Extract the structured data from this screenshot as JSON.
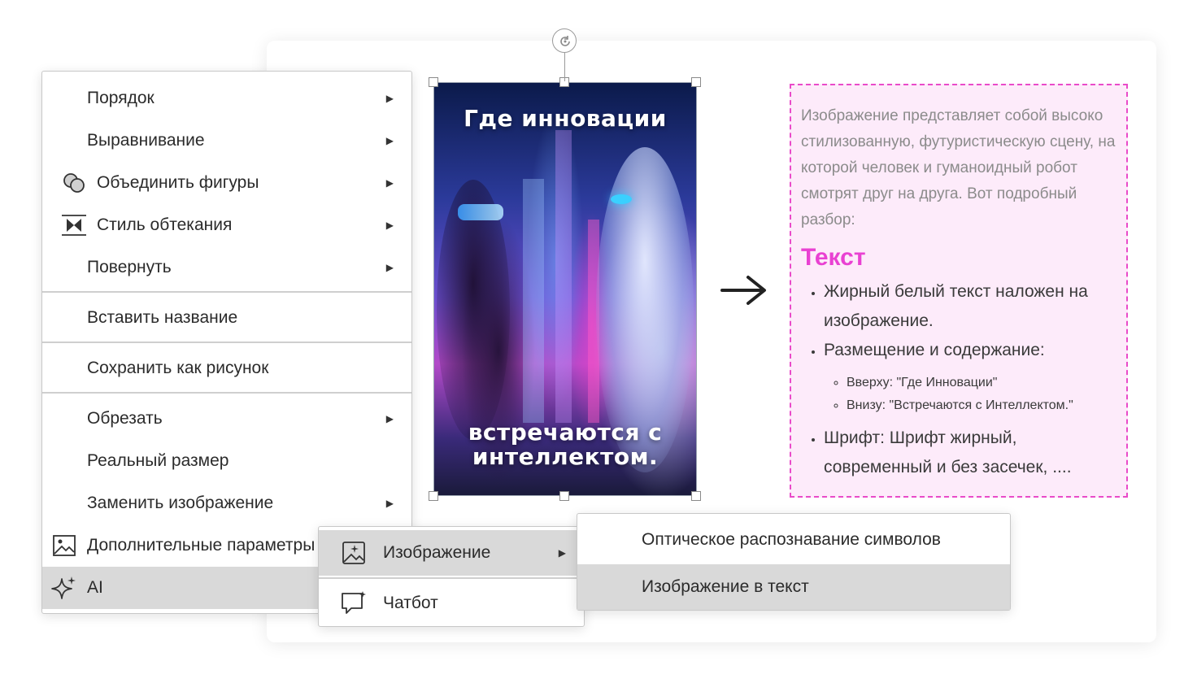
{
  "slide_image": {
    "headline_top": "Где инновации",
    "headline_bottom": "встречаются с интеллектом."
  },
  "result_box": {
    "description": "Изображение представляет собой высоко стилизованную, футуристическую сцену, на которой человек и гуманоидный робот смотрят друг на друга. Вот подробный разбор:",
    "heading": "Текст",
    "bullets": {
      "b1": "Жирный белый текст наложен на изображение.",
      "b2": "Размещение и содержание:",
      "b2_sub1": "Вверху: \"Где Инновации\"",
      "b2_sub2": "Внизу: \"Встречаются с Интеллектом.\"",
      "b3": "Шрифт: Шрифт жирный, современный и без засечек, ...."
    },
    "border_color": "#e94bc9",
    "heading_color": "#e941d2",
    "background_color": "#fdebfa"
  },
  "context_menu": {
    "order": "Порядок",
    "align": "Выравнивание",
    "merge_shapes": "Объединить фигуры",
    "wrap_style": "Стиль обтекания",
    "rotate": "Повернуть",
    "insert_caption": "Вставить название",
    "save_as_picture": "Сохранить как рисунок",
    "crop": "Обрезать",
    "actual_size": "Реальный размер",
    "replace_image": "Заменить изображение",
    "more_params": "Дополнительные параметры",
    "ai": "AI"
  },
  "ai_submenu": {
    "image": "Изображение",
    "chatbot": "Чатбот"
  },
  "image_submenu": {
    "ocr": "Оптическое распознавание символов",
    "image_to_text": "Изображение в текст"
  },
  "icons": {
    "merge_shapes": "merge-shapes-icon",
    "wrap_style": "wrap-style-icon",
    "more_params": "image-icon",
    "ai": "sparkle-icon",
    "image": "image-ai-icon",
    "chatbot": "chat-icon",
    "arrow": "arrow-right-icon",
    "rotate": "rotate-icon"
  },
  "highlight_color": "#d9d9d9"
}
